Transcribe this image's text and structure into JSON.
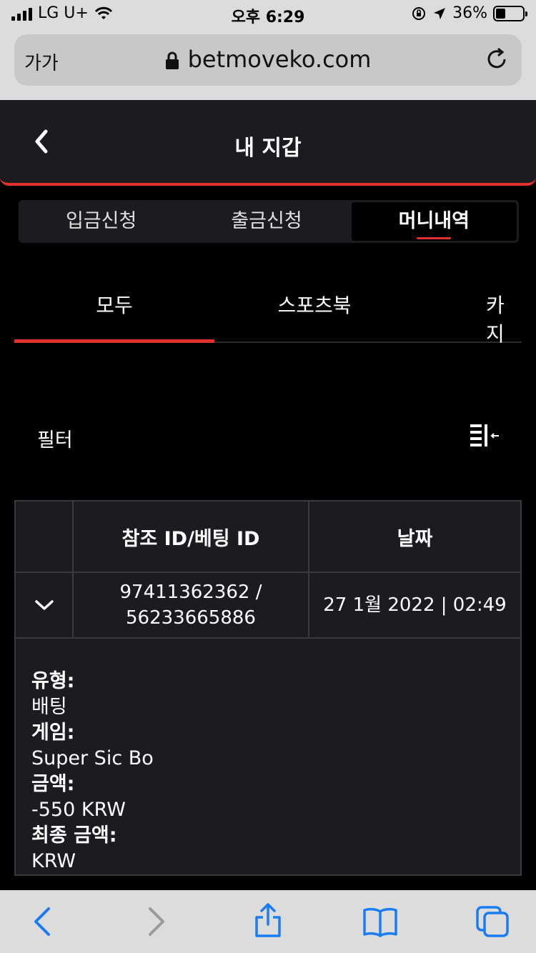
{
  "status_bar": {
    "carrier": "LG U+",
    "time": "오후 6:29",
    "battery": "36%",
    "battery_level": 0.36
  },
  "browser": {
    "text_size": "가가",
    "url": "betmoveko.com"
  },
  "header": {
    "title": "내 지갑"
  },
  "wallet_tabs": [
    "입금신청",
    "출금신청",
    "머니내역"
  ],
  "wallet_active_tab": 2,
  "category_tabs": [
    "모두",
    "스포츠북",
    "카지"
  ],
  "category_active_tab": 0,
  "filter": {
    "label": "필터"
  },
  "table": {
    "headers": [
      "",
      "참조 ID/베팅 ID",
      "날짜"
    ],
    "rows": [
      {
        "reference_id": "97411362362 /",
        "bet_id": "56233665886",
        "date": "27 1월 2022 | 02:49"
      }
    ],
    "details": [
      {
        "label": "유형:",
        "value": "배팅"
      },
      {
        "label": "게임:",
        "value": "Super Sic Bo"
      },
      {
        "label": "금액:",
        "value": "-550 KRW"
      },
      {
        "label": "최종 금액:",
        "value": "KRW"
      }
    ]
  },
  "colors": {
    "accent": "#e0312c",
    "panel": "#1c1c20",
    "ios_blue": "#1a7cf5"
  }
}
